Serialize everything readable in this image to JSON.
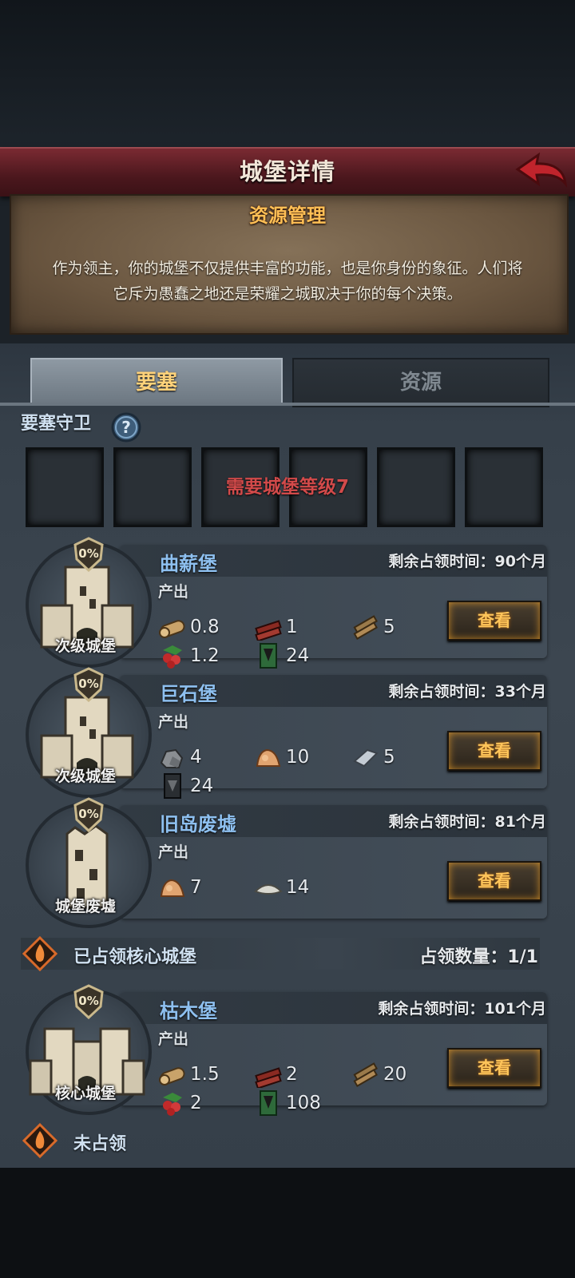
{
  "header": {
    "title": "城堡详情"
  },
  "info": {
    "title": "资源管理",
    "desc_line1": "作为领主，你的城堡不仅提供丰富的功能，也是你身份的象征。人们将",
    "desc_line2": "它斥为愚蠢之地还是荣耀之城取决于你的每个决策。"
  },
  "tabs": [
    {
      "label": "要塞",
      "active": true
    },
    {
      "label": "资源",
      "active": false
    }
  ],
  "guards": {
    "label": "要塞守卫",
    "help_icon": "question-icon",
    "locked_text": "需要城堡等级7"
  },
  "castles": [
    {
      "name": "曲薪堡",
      "type": "次级城堡",
      "percent": "0%",
      "remain_label": "剩余占领时间：",
      "remain_value": "90个月",
      "output_label": "产出",
      "resources": [
        {
          "icon": "wood-log-icon",
          "value": "0.8"
        },
        {
          "icon": "red-timber-icon",
          "value": "1"
        },
        {
          "icon": "planks-icon",
          "value": "5"
        },
        {
          "icon": "berries-icon",
          "value": "1.2"
        },
        {
          "icon": "green-banner-icon",
          "value": "24"
        }
      ],
      "view_label": "查看"
    },
    {
      "name": "巨石堡",
      "type": "次级城堡",
      "percent": "0%",
      "remain_label": "剩余占领时间：",
      "remain_value": "33个月",
      "output_label": "产出",
      "resources": [
        {
          "icon": "stone-icon",
          "value": "4"
        },
        {
          "icon": "ore-icon",
          "value": "10"
        },
        {
          "icon": "iron-ingot-icon",
          "value": "5"
        },
        {
          "icon": "dark-banner-icon",
          "value": "24"
        }
      ],
      "view_label": "查看"
    },
    {
      "name": "旧岛废墟",
      "type": "城堡废墟",
      "percent": "0%",
      "remain_label": "剩余占领时间：",
      "remain_value": "81个月",
      "output_label": "产出",
      "resources": [
        {
          "icon": "ore-icon",
          "value": "7"
        },
        {
          "icon": "salt-icon",
          "value": "14"
        }
      ],
      "view_label": "查看"
    }
  ],
  "core": {
    "label": "已占领核心城堡",
    "count_label": "占领数量：",
    "count_value": "1/1",
    "castle": {
      "name": "枯木堡",
      "type": "核心城堡",
      "percent": "0%",
      "remain_label": "剩余占领时间：",
      "remain_value": "101个月",
      "output_label": "产出",
      "resources": [
        {
          "icon": "wood-log-icon",
          "value": "1.5"
        },
        {
          "icon": "red-timber-icon",
          "value": "2"
        },
        {
          "icon": "planks-icon",
          "value": "20"
        },
        {
          "icon": "berries-icon",
          "value": "2"
        },
        {
          "icon": "green-banner-icon",
          "value": "108"
        }
      ],
      "view_label": "查看"
    }
  },
  "unoccupied": {
    "label": "未占领"
  },
  "colors": {
    "accent": "#ffbf55",
    "name_blue": "#8ec0f0",
    "lock_red": "#d24a4a"
  }
}
